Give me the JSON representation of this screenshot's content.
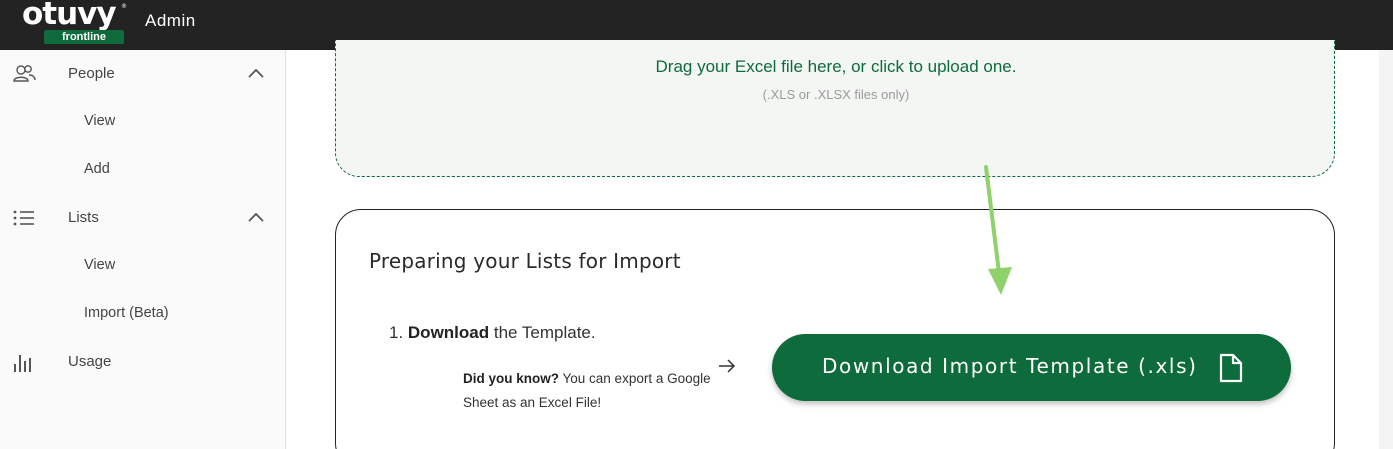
{
  "header": {
    "logo_text": "otuvy",
    "logo_registered": "®",
    "logo_sub": "frontline",
    "app_title": "Admin"
  },
  "sidebar": {
    "items": [
      {
        "label": "People",
        "icon": "people-icon",
        "expanded": true
      },
      {
        "label": "View"
      },
      {
        "label": "Add"
      },
      {
        "label": "Lists",
        "icon": "list-icon",
        "expanded": true
      },
      {
        "label": "View"
      },
      {
        "label": "Import (Beta)"
      },
      {
        "label": "Usage",
        "icon": "bar-chart-icon"
      }
    ]
  },
  "dropzone": {
    "text": "Drag your Excel file here, or click to upload one.",
    "hint": "(.XLS or .XLSX files only)"
  },
  "card": {
    "title": "Preparing your Lists for Import",
    "step_prefix": "1. ",
    "step_bold": "Download",
    "step_rest": " the Template.",
    "tip_bold": "Did you know?",
    "tip_rest": " You can export a Google Sheet as an Excel File!",
    "download_button": "Download Import Template (.xls)"
  },
  "colors": {
    "brand_green": "#0e6b3b",
    "annotation_arrow": "#8fd16a",
    "topbar": "#232323"
  }
}
